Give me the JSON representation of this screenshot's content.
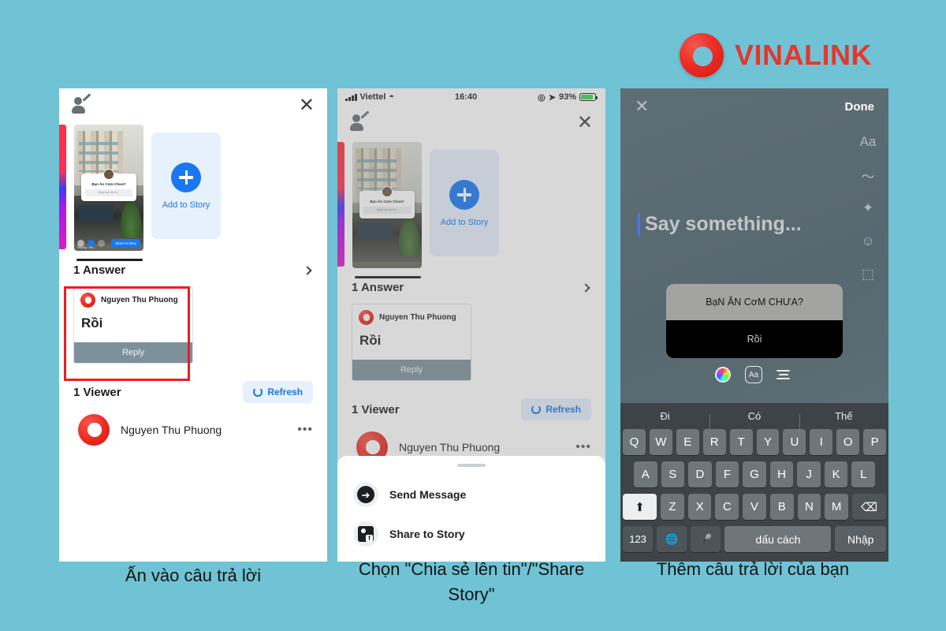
{
  "brand": {
    "name": "VINALINK",
    "logo_color": "#ee2d24"
  },
  "background_color": "#6fc3d4",
  "panel1": {
    "icons": {
      "profile": "person-edit-icon",
      "close": "✕"
    },
    "add_story_label": "Add to Story",
    "answers_title": "1 Answer",
    "answer_card": {
      "author": "Nguyen Thu Phuong",
      "text": "Rồi",
      "reply_label": "Reply"
    },
    "viewers_title": "1 Viewer",
    "refresh_label": "Refresh",
    "viewer": {
      "name": "Nguyen Thu Phuong",
      "more": "•••"
    },
    "story_thumb": {
      "question": "Bạn Ăn Cơm Chưa?",
      "input_placeholder": "Nhập câu trả lời...",
      "share_label": "Share to Story",
      "meta": "Phuong · 9hư ..."
    },
    "highlight_color": "#ed1c24"
  },
  "panel2": {
    "status_bar": {
      "carrier": "Viettel",
      "time": "16:40",
      "battery": "93%"
    },
    "add_story_label": "Add to Story",
    "answers_title": "1 Answer",
    "answer_card": {
      "author": "Nguyen Thu Phuong",
      "text": "Rồi",
      "reply_label": "Reply"
    },
    "viewers_title": "1 Viewer",
    "refresh_label": "Refresh",
    "viewer": {
      "name": "Nguyen Thu Phuong",
      "more": "•••"
    },
    "sheet_items": [
      {
        "label": "Send Message",
        "icon": "messenger-icon"
      },
      {
        "label": "Share to Story",
        "icon": "share-story-icon"
      }
    ]
  },
  "panel3": {
    "close": "✕",
    "done_label": "Done",
    "placeholder_text": "Say something...",
    "tools": [
      {
        "name": "text-tool-icon",
        "glyph": "Aa"
      },
      {
        "name": "draw-tool-icon",
        "glyph": "〜"
      },
      {
        "name": "effects-wand-icon",
        "glyph": "✦"
      },
      {
        "name": "tag-person-icon",
        "glyph": "☺"
      },
      {
        "name": "sticker-frame-icon",
        "glyph": "⬚"
      }
    ],
    "quote_card": {
      "question": "BạN ĂN CơM CHƯA?",
      "answer": "Rồi"
    },
    "card_tools": [
      {
        "name": "color-wheel-icon"
      },
      {
        "name": "font-aa-icon",
        "label": "Aa"
      },
      {
        "name": "text-align-icon"
      }
    ],
    "keyboard": {
      "suggestions": [
        "Đi",
        "Có",
        "Thế"
      ],
      "row1": [
        "Q",
        "W",
        "E",
        "R",
        "T",
        "Y",
        "U",
        "I",
        "O",
        "P"
      ],
      "row2": [
        "A",
        "S",
        "D",
        "F",
        "G",
        "H",
        "J",
        "K",
        "L"
      ],
      "row3": [
        "Z",
        "X",
        "C",
        "V",
        "B",
        "N",
        "M"
      ],
      "shift": "⬆",
      "backspace": "⌫",
      "numbers": "123",
      "globe": "⊕",
      "mic": "⬤",
      "space": "dấu cách",
      "enter": "Nhập"
    }
  },
  "captions": {
    "step1": "Ấn vào câu trả lời",
    "step2": "Chọn \"Chia sẻ lên tin\"/\"Share Story\"",
    "step3": "Thêm câu trả lời của bạn"
  }
}
